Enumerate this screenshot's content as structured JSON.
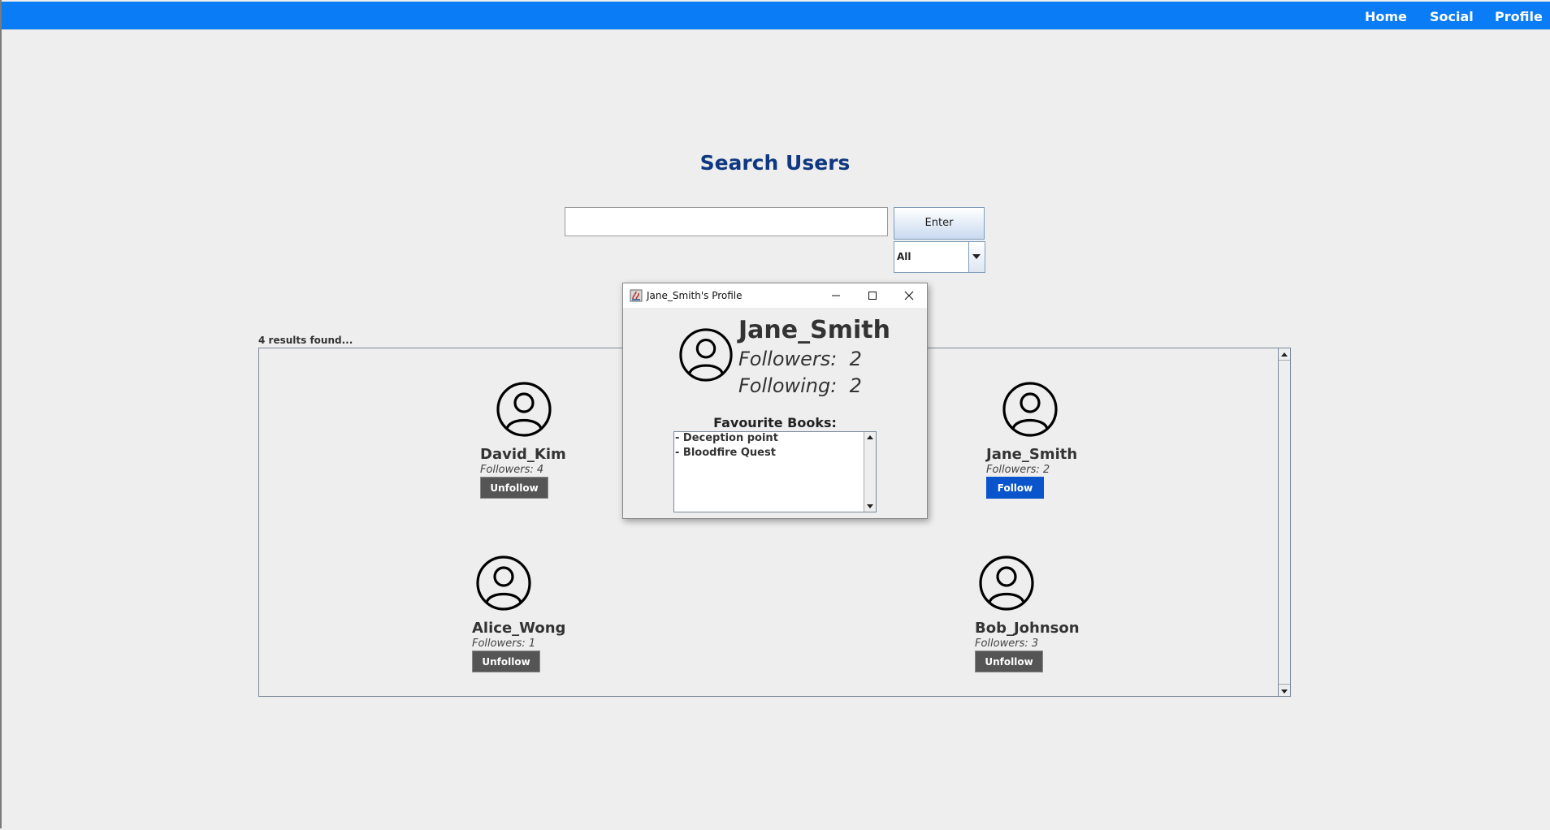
{
  "nav": {
    "links": [
      {
        "label": "Home"
      },
      {
        "label": "Social"
      },
      {
        "label": "Profile"
      }
    ]
  },
  "title": "Search Users",
  "search": {
    "value": "",
    "placeholder": "",
    "enter_label": "Enter",
    "filter_value": "All"
  },
  "results": {
    "count_text": "4 results found...",
    "users": [
      {
        "name": "David_Kim",
        "followers": "Followers: 4",
        "action": "Unfollow"
      },
      {
        "name": "Jane_Smith",
        "followers": "Followers: 2",
        "action": "Follow"
      },
      {
        "name": "Alice_Wong",
        "followers": "Followers: 1",
        "action": "Unfollow"
      },
      {
        "name": "Bob_Johnson",
        "followers": "Followers: 3",
        "action": "Unfollow"
      }
    ]
  },
  "dialog": {
    "title": "Jane_Smith's Profile",
    "name": "Jane_Smith",
    "followers_label": "Followers:",
    "followers_value": "2",
    "following_label": "Following:",
    "following_value": "2",
    "favourites_title": "Favourite Books:",
    "favourites": [
      "- Deception point",
      "- Bloodfire Quest"
    ]
  },
  "colors": {
    "navbar": "#0a7cf6",
    "title": "#0f3880",
    "follow_button": "#0a55cc",
    "unfollow_button": "#555555"
  }
}
